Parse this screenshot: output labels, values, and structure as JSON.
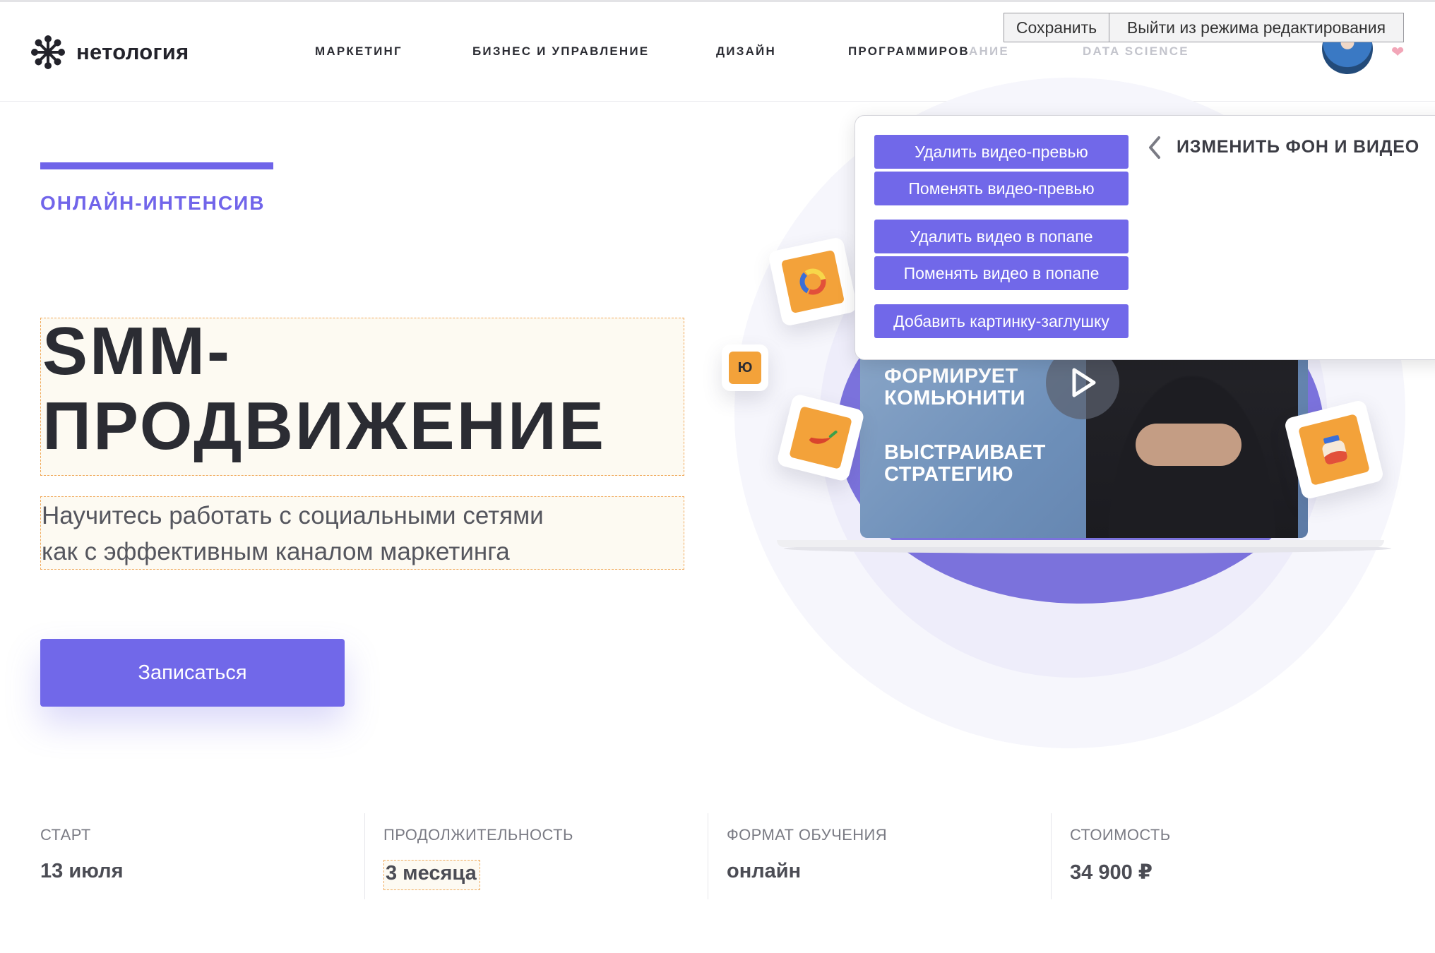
{
  "header": {
    "logo_text": "нетология",
    "nav": [
      "МАРКЕТИНГ",
      "БИЗНЕС И УПРАВЛЕНИЕ",
      "ДИЗАЙН",
      "ПРОГРАММИРОВ",
      "АНИЕ",
      "DATA SCIENCE"
    ]
  },
  "editor": {
    "save_label": "Сохранить",
    "exit_label": "Выйти из режима редактирования",
    "panel": {
      "title": "ИЗМЕНИТЬ ФОН И ВИДЕО",
      "buttons": [
        "Удалить видео-превью",
        "Поменять видео-превью",
        "Удалить видео в попапе",
        "Поменять видео в попапе",
        "Добавить картинку-заглушку"
      ]
    }
  },
  "hero": {
    "eyebrow": "ОНЛАЙН-ИНТЕНСИВ",
    "title_line1": "SMM-",
    "title_line2": "ПРОДВИЖЕНИЕ",
    "subtitle_line1": "Научитесь работать с социальными сетями",
    "subtitle_line2": "как с эффективным каналом маркетинга",
    "cta_label": "Записаться"
  },
  "video": {
    "text_line1": "ФОРМИРУЕТ",
    "text_line2": "КОМЬЮНИТИ",
    "text_line3": "ВЫСТРАИВАЕТ",
    "text_line4": "СТРАТЕГИЮ"
  },
  "tiles": {
    "small_label": "Ю"
  },
  "stats": [
    {
      "label": "СТАРТ",
      "value": "13 июля"
    },
    {
      "label": "ПРОДОЛЖИТЕЛЬНОСТЬ",
      "value": "3 месяца"
    },
    {
      "label": "ФОРМАТ ОБУЧЕНИЯ",
      "value": "онлайн"
    },
    {
      "label": "СТОИМОСТЬ",
      "value": "34 900 ₽"
    }
  ],
  "colors": {
    "accent": "#7168e9",
    "tile_orange": "#f3a23a",
    "edit_highlight": "#fdfaf2"
  }
}
